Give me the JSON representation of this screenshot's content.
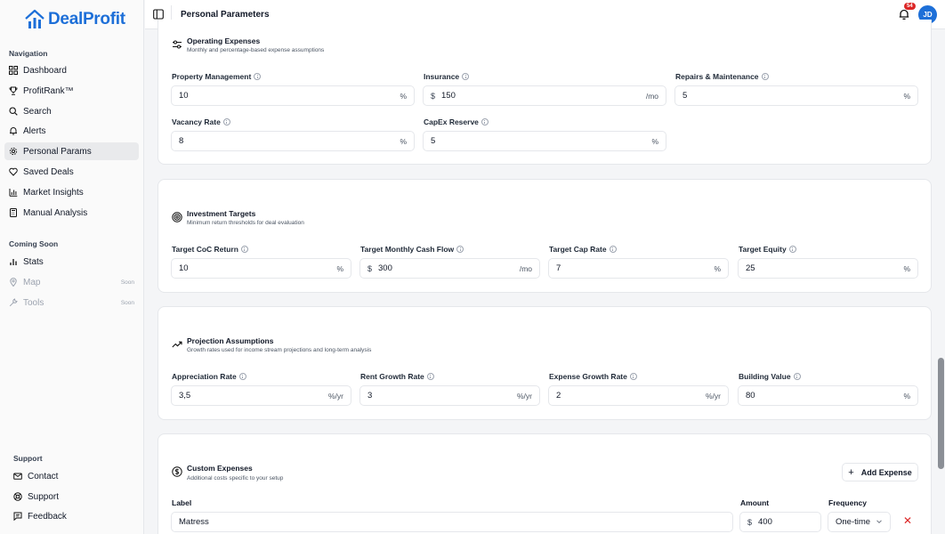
{
  "app": {
    "name_part1": "Deal",
    "name_part2": "Profit",
    "brand_color": "#1d6fd8"
  },
  "header": {
    "title": "Personal Parameters",
    "notifications": "54",
    "avatar_initials": "JD"
  },
  "sidebar": {
    "nav_heading": "Navigation",
    "items": [
      {
        "label": "Dashboard",
        "icon": "grid-icon"
      },
      {
        "label": "ProfitRank™",
        "icon": "trophy-icon"
      },
      {
        "label": "Search",
        "icon": "search-icon"
      },
      {
        "label": "Alerts",
        "icon": "alert-icon"
      },
      {
        "label": "Personal Params",
        "icon": "gear-icon"
      },
      {
        "label": "Saved Deals",
        "icon": "heart-icon"
      },
      {
        "label": "Market Insights",
        "icon": "bar-chart-icon"
      },
      {
        "label": "Manual Analysis",
        "icon": "calculator-icon"
      }
    ],
    "coming_soon_heading": "Coming Soon",
    "soon_items": [
      {
        "label": "Stats",
        "icon": "stats-icon",
        "badge": ""
      },
      {
        "label": "Map",
        "icon": "map-pin-icon",
        "badge": "Soon"
      },
      {
        "label": "Tools",
        "icon": "wrench-icon",
        "badge": "Soon"
      }
    ],
    "support_heading": "Support",
    "support_items": [
      {
        "label": "Contact",
        "icon": "mail-icon"
      },
      {
        "label": "Support",
        "icon": "lifebuoy-icon"
      },
      {
        "label": "Feedback",
        "icon": "message-icon"
      }
    ]
  },
  "operating": {
    "title": "Operating Expenses",
    "subtitle": "Monthly and percentage-based expense assumptions",
    "fields": [
      {
        "label": "Property Management",
        "prefix": "",
        "value": "10",
        "suffix": "%"
      },
      {
        "label": "Insurance",
        "prefix": "$",
        "value": "150",
        "suffix": "/mo"
      },
      {
        "label": "Repairs & Maintenance",
        "prefix": "",
        "value": "5",
        "suffix": "%"
      },
      {
        "label": "Vacancy Rate",
        "prefix": "",
        "value": "8",
        "suffix": "%"
      },
      {
        "label": "CapEx Reserve",
        "prefix": "",
        "value": "5",
        "suffix": "%"
      }
    ]
  },
  "investment": {
    "title": "Investment Targets",
    "subtitle": "Minimum return thresholds for deal evaluation",
    "fields": [
      {
        "label": "Target CoC Return",
        "prefix": "",
        "value": "10",
        "suffix": "%"
      },
      {
        "label": "Target Monthly Cash Flow",
        "prefix": "$",
        "value": "300",
        "suffix": "/mo"
      },
      {
        "label": "Target Cap Rate",
        "prefix": "",
        "value": "7",
        "suffix": "%"
      },
      {
        "label": "Target Equity",
        "prefix": "",
        "value": "25",
        "suffix": "%"
      }
    ]
  },
  "projection": {
    "title": "Projection Assumptions",
    "subtitle": "Growth rates used for income stream projections and long-term analysis",
    "fields": [
      {
        "label": "Appreciation Rate",
        "prefix": "",
        "value": "3,5",
        "suffix": "%/yr"
      },
      {
        "label": "Rent Growth Rate",
        "prefix": "",
        "value": "3",
        "suffix": "%/yr"
      },
      {
        "label": "Expense Growth Rate",
        "prefix": "",
        "value": "2",
        "suffix": "%/yr"
      },
      {
        "label": "Building Value",
        "prefix": "",
        "value": "80",
        "suffix": "%"
      }
    ]
  },
  "custom": {
    "title": "Custom Expenses",
    "subtitle": "Additional costs specific to your setup",
    "add_label": "Add Expense",
    "label_header": "Label",
    "amount_header": "Amount",
    "frequency_header": "Frequency",
    "row": {
      "label": "Matress",
      "prefix": "$",
      "amount": "400",
      "frequency": "One-time"
    }
  }
}
